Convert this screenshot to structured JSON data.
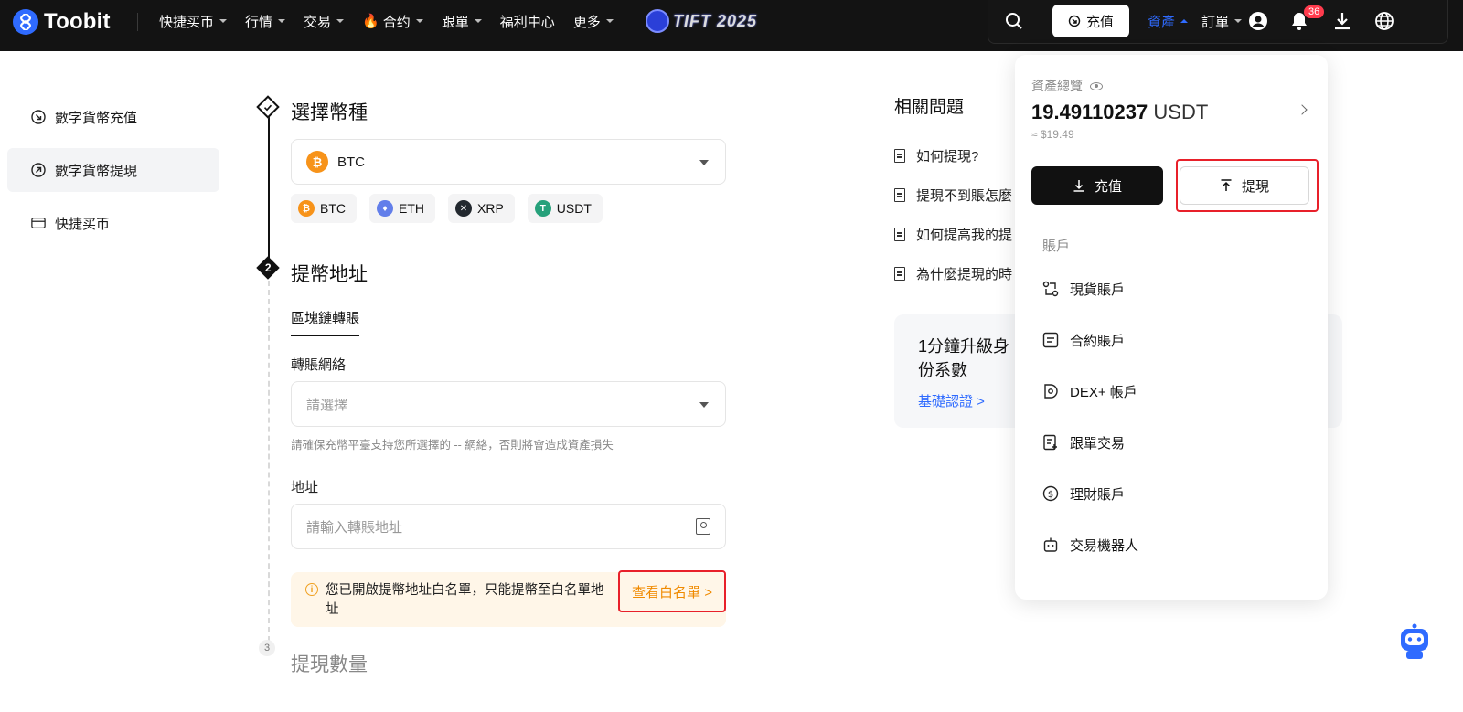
{
  "brand": {
    "name": "Toobit"
  },
  "nav": {
    "items": [
      {
        "label": "快捷买币",
        "has_caret": true
      },
      {
        "label": "行情",
        "has_caret": true
      },
      {
        "label": "交易",
        "has_caret": true
      },
      {
        "label": "合约",
        "has_caret": true,
        "icon": "fire-icon"
      },
      {
        "label": "跟單",
        "has_caret": true
      },
      {
        "label": "福利中心",
        "has_caret": false
      },
      {
        "label": "更多",
        "has_caret": true
      }
    ],
    "promo_text": "TIFT 2025"
  },
  "header_right": {
    "deposit_label": "充值",
    "assets_label": "資產",
    "orders_label": "訂單",
    "notification_count": "36"
  },
  "sidebar": {
    "items": [
      {
        "label": "數字貨幣充值",
        "icon": "arrow-down-circle-icon",
        "active": false
      },
      {
        "label": "數字貨幣提現",
        "icon": "arrow-up-circle-icon",
        "active": true
      },
      {
        "label": "快捷买币",
        "icon": "card-icon",
        "active": false
      }
    ]
  },
  "steps": {
    "step1_title": "選擇幣種",
    "step2_title": "提幣地址",
    "step3_title": "提現數量",
    "step3_number": "3",
    "step2_number": "2"
  },
  "coin_select": {
    "selected": "BTC",
    "symbol": "₿",
    "quick_coins": [
      {
        "label": "BTC",
        "symbol": "₿",
        "color": "#f7931a"
      },
      {
        "label": "ETH",
        "symbol": "♦",
        "color": "#627eea"
      },
      {
        "label": "XRP",
        "symbol": "✕",
        "color": "#23292f"
      },
      {
        "label": "USDT",
        "symbol": "T",
        "color": "#26a17b"
      }
    ]
  },
  "address": {
    "tab_label": "區塊鏈轉賬",
    "network_label": "轉賬網絡",
    "network_placeholder": "請選擇",
    "network_hint": "請確保充幣平臺支持您所選擇的 -- 網絡，否則將會造成資產損失",
    "address_label": "地址",
    "address_placeholder": "請輸入轉賬地址",
    "notice_text": "您已開啟提幣地址白名單，只能提幣至白名單地址",
    "whitelist_link": "查看白名單 >"
  },
  "faq": {
    "title": "相關問題",
    "items": [
      "如何提現?",
      "提現不到賬怎麼",
      "如何提高我的提",
      "為什麼提現的時"
    ]
  },
  "promo_card": {
    "title": "1分鐘升級身份系數",
    "link": "基礎認證 >"
  },
  "asset_dropdown": {
    "overview_label": "資產總覽",
    "balance": "19.49110237",
    "balance_unit": "USDT",
    "balance_approx": "≈ $19.49",
    "deposit_btn": "充值",
    "withdraw_btn": "提現",
    "section_label": "賬戶",
    "accounts": [
      {
        "label": "現貨賬戶",
        "icon": "swap-icon"
      },
      {
        "label": "合約賬戶",
        "icon": "contract-icon"
      },
      {
        "label": "DEX+ 帳戶",
        "icon": "dex-icon"
      },
      {
        "label": "跟單交易",
        "icon": "copy-trade-icon"
      },
      {
        "label": "理財賬戶",
        "icon": "earn-icon"
      },
      {
        "label": "交易機器人",
        "icon": "robot-icon"
      }
    ]
  },
  "colors": {
    "accent": "#2f6bff",
    "topbar": "#131313",
    "highlight_border": "#e8202a",
    "warning": "#f08a00"
  }
}
